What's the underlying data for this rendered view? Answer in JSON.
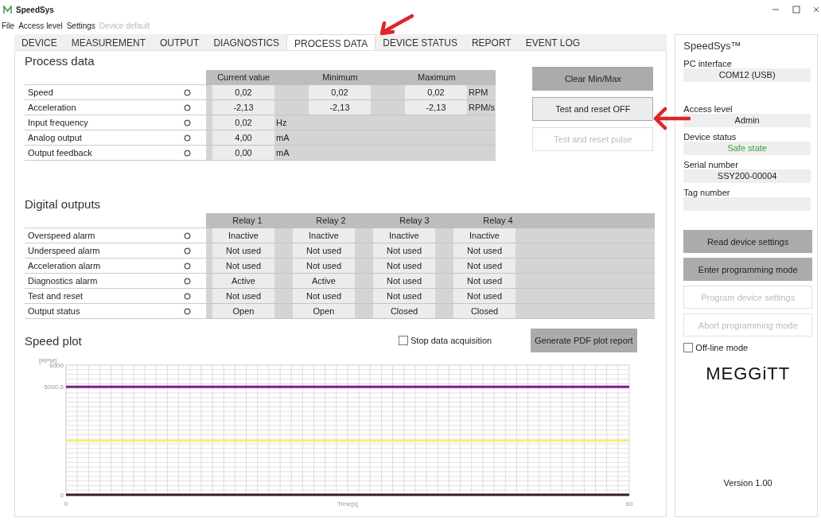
{
  "window": {
    "title": "SpeedSys"
  },
  "menu": [
    {
      "label": "File",
      "disabled": false
    },
    {
      "label": "Access level",
      "disabled": false
    },
    {
      "label": "Settings",
      "disabled": false
    },
    {
      "label": "Device default",
      "disabled": true
    }
  ],
  "tabs": [
    {
      "label": "DEVICE",
      "selected": false
    },
    {
      "label": "MEASUREMENT",
      "selected": false
    },
    {
      "label": "OUTPUT",
      "selected": false
    },
    {
      "label": "DIAGNOSTICS",
      "selected": false
    },
    {
      "label": "PROCESS DATA",
      "selected": true
    },
    {
      "label": "DEVICE STATUS",
      "selected": false
    },
    {
      "label": "REPORT",
      "selected": false
    },
    {
      "label": "EVENT LOG",
      "selected": false
    }
  ],
  "process_data": {
    "title": "Process data",
    "columns": [
      "Current value",
      "Minimum",
      "Maximum"
    ],
    "rows": [
      {
        "label": "Speed",
        "values": [
          "0,02",
          "0,02",
          "0,02"
        ],
        "unit": "RPM"
      },
      {
        "label": "Acceleration",
        "values": [
          "-2,13",
          "-2,13",
          "-2,13"
        ],
        "unit": "RPM/s"
      },
      {
        "label": "Input frequency",
        "values": [
          "0,02"
        ],
        "unit": "Hz"
      },
      {
        "label": "Analog output",
        "values": [
          "4,00"
        ],
        "unit": "mA"
      },
      {
        "label": "Output feedback",
        "values": [
          "0,00"
        ],
        "unit": "mA"
      }
    ],
    "buttons": [
      {
        "label": "Clear Min/Max",
        "kind": "filled",
        "disabled": false
      },
      {
        "label": "Test and reset OFF",
        "kind": "outlined",
        "disabled": false
      },
      {
        "label": "Test and reset pulse",
        "kind": "outlined",
        "disabled": true
      }
    ]
  },
  "digital_outputs": {
    "title": "Digital outputs",
    "columns": [
      "Relay 1",
      "Relay 2",
      "Relay 3",
      "Relay 4"
    ],
    "rows": [
      {
        "label": "Overspeed alarm",
        "values": [
          "Inactive",
          "Inactive",
          "Inactive",
          "Inactive"
        ]
      },
      {
        "label": "Underspeed alarm",
        "values": [
          "Not used",
          "Not used",
          "Not used",
          "Not used"
        ]
      },
      {
        "label": "Acceleration alarm",
        "values": [
          "Not used",
          "Not used",
          "Not used",
          "Not used"
        ]
      },
      {
        "label": "Diagnostics alarm",
        "values": [
          "Active",
          "Active",
          "Not used",
          "Not used"
        ]
      },
      {
        "label": "Test and reset",
        "values": [
          "Not used",
          "Not used",
          "Not used",
          "Not used"
        ]
      },
      {
        "label": "Output status",
        "values": [
          "Open",
          "Open",
          "Closed",
          "Closed"
        ]
      }
    ]
  },
  "speed_plot": {
    "title": "Speed plot",
    "stop_acquisition": {
      "label": "Stop data acquisition",
      "checked": false
    },
    "report_button": "Generate PDF plot report",
    "chart_data": {
      "type": "line",
      "xlabel": "Time[s]",
      "ylabel": "[RPM]",
      "x": [
        0,
        60
      ],
      "xlim": [
        0,
        60
      ],
      "ylim": [
        0,
        6000
      ],
      "xticks": [
        0,
        60
      ],
      "yticks": [
        0,
        {
          "value": 5000.5,
          "label": "5000,5"
        },
        6000
      ],
      "series": [
        {
          "color": "#7b1f8c",
          "values": [
            5000,
            5000
          ]
        },
        {
          "color": "#f2f27a",
          "values": [
            2500,
            2500
          ]
        },
        {
          "color": "#3b1830",
          "values": [
            0,
            0
          ]
        }
      ]
    }
  },
  "sidebar": {
    "title": "SpeedSys™",
    "fields": [
      {
        "label": "PC interface",
        "value": "COM12 (USB)"
      },
      {
        "label": "Access level",
        "value": "Admin"
      },
      {
        "label": "Device status",
        "value": "Safe state",
        "color": "#3aa53a"
      },
      {
        "label": "Serial number",
        "value": "SSY200-00004"
      },
      {
        "label": "Tag number"
      }
    ],
    "buttons": [
      {
        "label": "Read device settings",
        "kind": "filled",
        "disabled": false
      },
      {
        "label": "Enter programming mode",
        "kind": "filled",
        "disabled": false
      },
      {
        "label": "Program device settings",
        "kind": "outlined",
        "disabled": true
      },
      {
        "label": "Abort programming mode",
        "kind": "outlined",
        "disabled": true
      }
    ],
    "offline_mode": {
      "label": "Off-line mode",
      "checked": false
    },
    "logo": "MEGGiTT",
    "version": "Version 1.00"
  }
}
